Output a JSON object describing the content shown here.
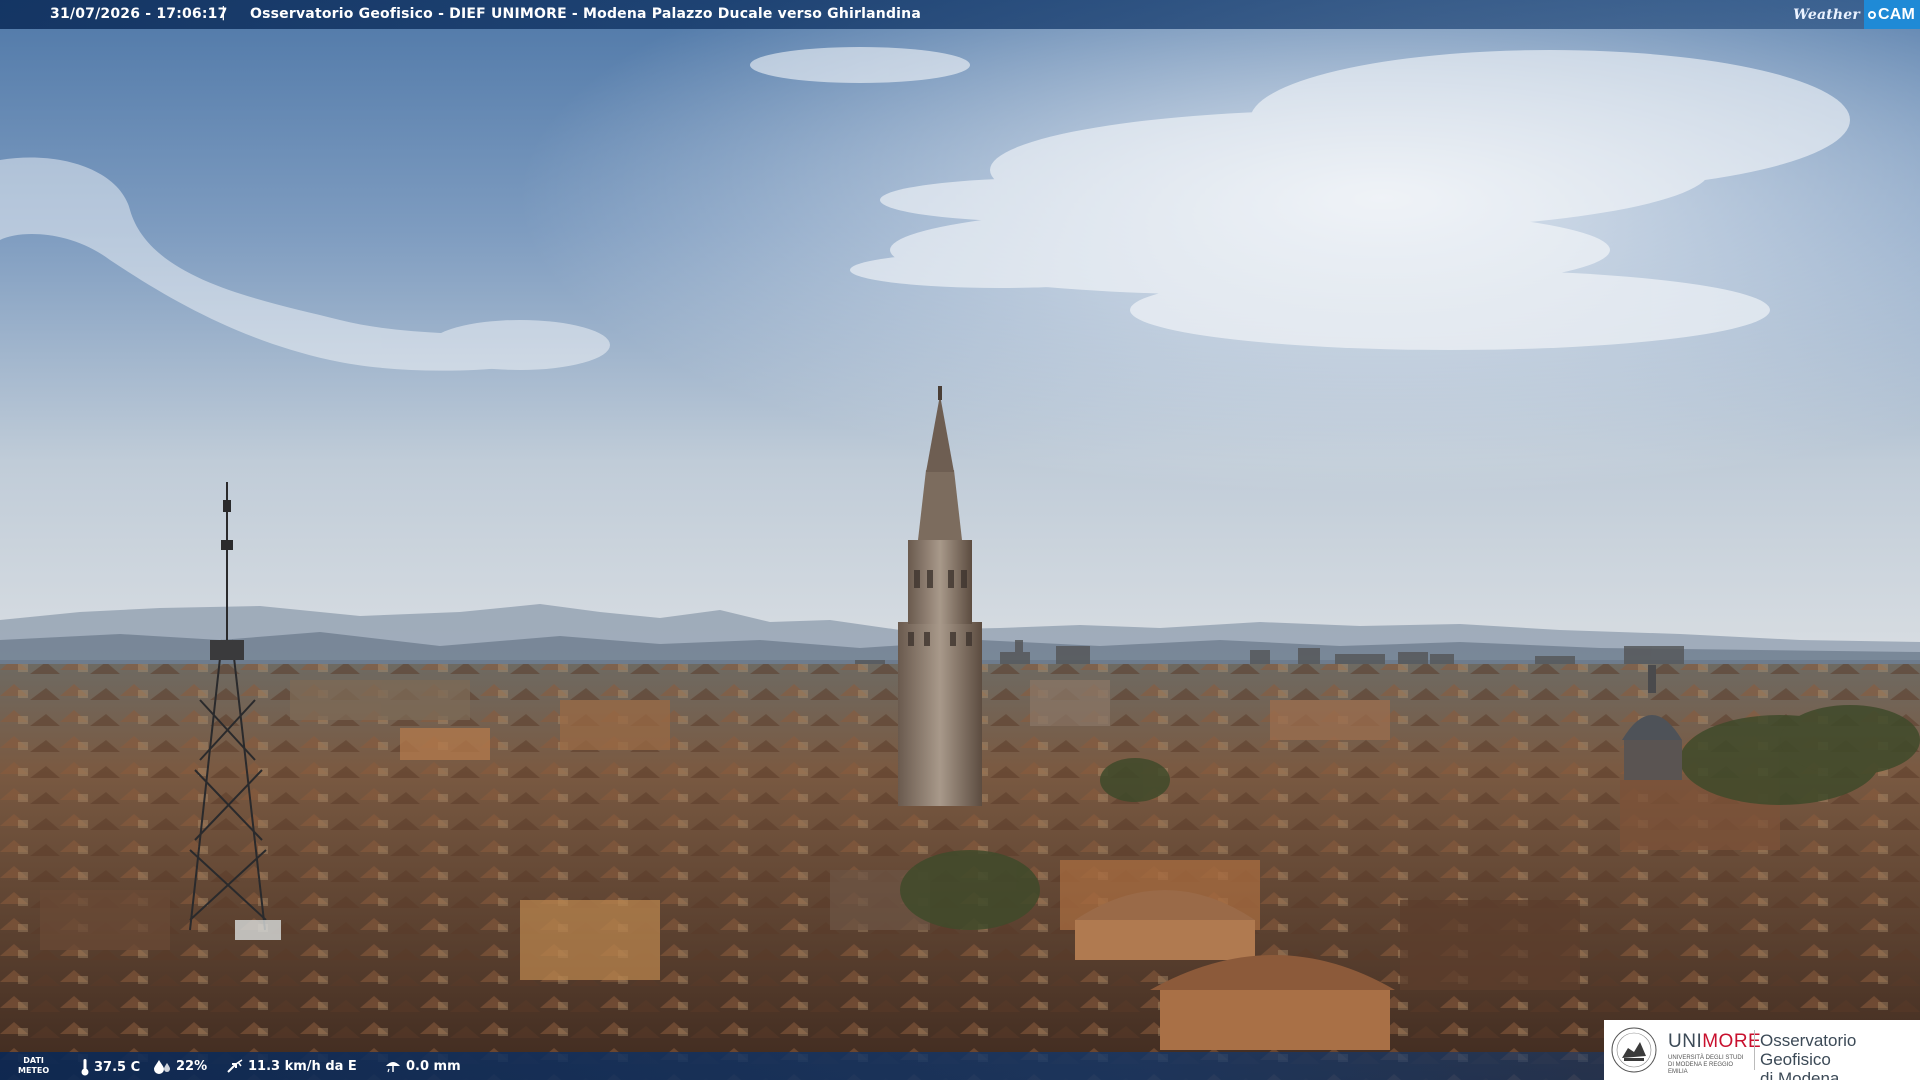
{
  "header": {
    "timestamp": "31/07/2026 - 17:06:17",
    "separator": "|",
    "title": "Osservatorio Geofisico - DIEF UNIMORE - Modena Palazzo Ducale verso Ghirlandina",
    "brand_weather": "Weather",
    "brand_cam": "CAM"
  },
  "weather": {
    "label_line1": "DATI",
    "label_line2": "METEO",
    "temperature": "37.5 C",
    "humidity": "22%",
    "wind": "11.3 km/h da E",
    "rain": "0.0 mm"
  },
  "logo": {
    "uni_part1": "UNI",
    "uni_part2": "MORE",
    "uni_subtitle": "UNIVERSITÀ DEGLI STUDI DI MODENA E REGGIO EMILIA",
    "observatory_line1": "Osservatorio Geofisico",
    "observatory_line2": "di Modena"
  },
  "colors": {
    "bar_blue": "#0c2c5a",
    "cam_blue": "#1f8ad6",
    "unimore_red": "#c8102e"
  }
}
